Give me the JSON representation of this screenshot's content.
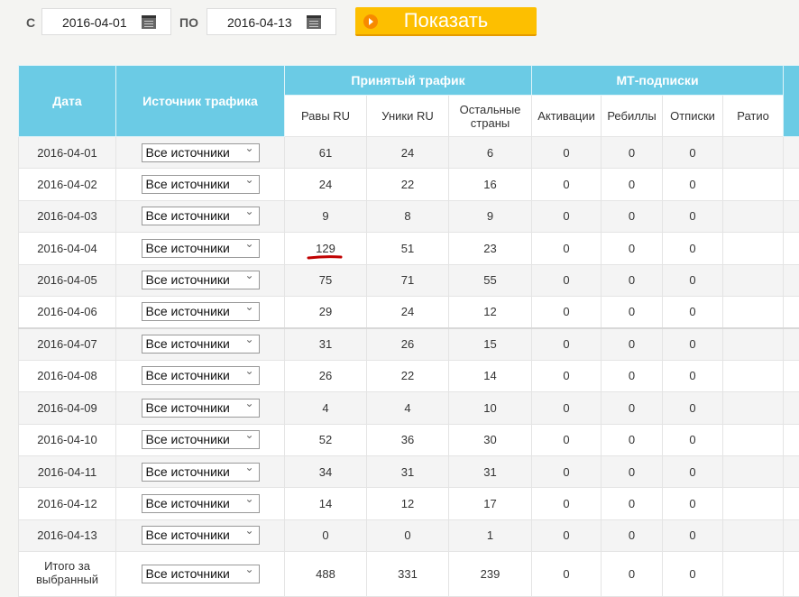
{
  "filter": {
    "from_label": "С",
    "from_value": "2016-04-01",
    "to_label": "ПО",
    "to_value": "2016-04-13",
    "show_button": "Показать"
  },
  "table": {
    "headers": {
      "date": "Дата",
      "source": "Источник трафика",
      "traffic_group": "Принятый трафик",
      "mt_group": "МТ-подписки",
      "sub": [
        "Равы RU",
        "Уники RU",
        "Остальные страны",
        "Активации",
        "Ребиллы",
        "Отписки",
        "Ратио"
      ]
    },
    "rows": [
      {
        "date": "2016-04-01",
        "source": "Все источники",
        "cells": [
          "61",
          "24",
          "6",
          "0",
          "0",
          "0",
          ""
        ]
      },
      {
        "date": "2016-04-02",
        "source": "Все источники",
        "cells": [
          "24",
          "22",
          "16",
          "0",
          "0",
          "0",
          ""
        ]
      },
      {
        "date": "2016-04-03",
        "source": "Все источники",
        "cells": [
          "9",
          "8",
          "9",
          "0",
          "0",
          "0",
          ""
        ]
      },
      {
        "date": "2016-04-04",
        "source": "Все источники",
        "cells": [
          "129",
          "51",
          "23",
          "0",
          "0",
          "0",
          ""
        ]
      },
      {
        "date": "2016-04-05",
        "source": "Все источники",
        "cells": [
          "75",
          "71",
          "55",
          "0",
          "0",
          "0",
          ""
        ]
      },
      {
        "date": "2016-04-06",
        "source": "Все источники",
        "cells": [
          "29",
          "24",
          "12",
          "0",
          "0",
          "0",
          ""
        ]
      },
      {
        "date": "2016-04-07",
        "source": "Все источники",
        "cells": [
          "31",
          "26",
          "15",
          "0",
          "0",
          "0",
          ""
        ]
      },
      {
        "date": "2016-04-08",
        "source": "Все источники",
        "cells": [
          "26",
          "22",
          "14",
          "0",
          "0",
          "0",
          ""
        ]
      },
      {
        "date": "2016-04-09",
        "source": "Все источники",
        "cells": [
          "4",
          "4",
          "10",
          "0",
          "0",
          "0",
          ""
        ]
      },
      {
        "date": "2016-04-10",
        "source": "Все источники",
        "cells": [
          "52",
          "36",
          "30",
          "0",
          "0",
          "0",
          ""
        ]
      },
      {
        "date": "2016-04-11",
        "source": "Все источники",
        "cells": [
          "34",
          "31",
          "31",
          "0",
          "0",
          "0",
          ""
        ]
      },
      {
        "date": "2016-04-12",
        "source": "Все источники",
        "cells": [
          "14",
          "12",
          "17",
          "0",
          "0",
          "0",
          ""
        ]
      },
      {
        "date": "2016-04-13",
        "source": "Все источники",
        "cells": [
          "0",
          "0",
          "1",
          "0",
          "0",
          "0",
          ""
        ]
      }
    ],
    "total": {
      "date": "Итого за выбранный",
      "source": "Все источники",
      "cells": [
        "488",
        "331",
        "239",
        "0",
        "0",
        "0",
        ""
      ]
    }
  },
  "colors": {
    "header": "#6bcbe5",
    "button": "#fdbf00",
    "annotation": "#c00000"
  }
}
